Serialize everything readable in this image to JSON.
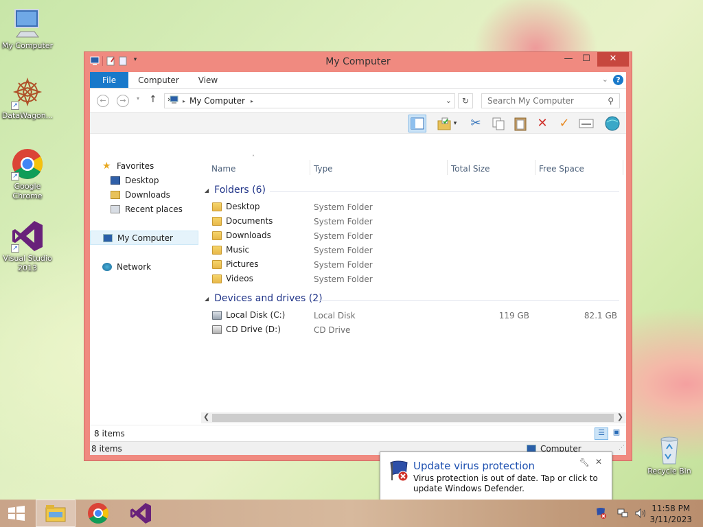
{
  "desktop": {
    "icons": [
      {
        "label": "My Computer"
      },
      {
        "label": "DataWagon..."
      },
      {
        "label": "Google Chrome"
      },
      {
        "label": "Visual Studio 2013"
      },
      {
        "label": "Recycle Bin"
      }
    ]
  },
  "window": {
    "title": "My Computer",
    "ribbon_tabs": [
      "File",
      "Computer",
      "View"
    ],
    "address": {
      "root_label": "My Computer"
    },
    "search": {
      "placeholder": "Search My Computer"
    },
    "nav": {
      "favorites": "Favorites",
      "favorites_items": [
        "Desktop",
        "Downloads",
        "Recent places"
      ],
      "my_computer": "My Computer",
      "network": "Network"
    },
    "columns": [
      "Name",
      "Type",
      "Total Size",
      "Free Space"
    ],
    "groups": [
      {
        "title": "Folders (6)",
        "items": [
          {
            "name": "Desktop",
            "type": "System Folder",
            "total": "",
            "free": ""
          },
          {
            "name": "Documents",
            "type": "System Folder",
            "total": "",
            "free": ""
          },
          {
            "name": "Downloads",
            "type": "System Folder",
            "total": "",
            "free": ""
          },
          {
            "name": "Music",
            "type": "System Folder",
            "total": "",
            "free": ""
          },
          {
            "name": "Pictures",
            "type": "System Folder",
            "total": "",
            "free": ""
          },
          {
            "name": "Videos",
            "type": "System Folder",
            "total": "",
            "free": ""
          }
        ]
      },
      {
        "title": "Devices and drives (2)",
        "items": [
          {
            "name": "Local Disk (C:)",
            "type": "Local Disk",
            "total": "119 GB",
            "free": "82.1 GB"
          },
          {
            "name": "CD Drive (D:)",
            "type": "CD Drive",
            "total": "",
            "free": ""
          }
        ]
      }
    ],
    "status_items": "8 items",
    "status_bottom_left": "8 items",
    "status_bottom_right": "Computer"
  },
  "toast": {
    "title": "Update virus protection",
    "message": "Virus protection is out of date. Tap or click to update Windows Defender."
  },
  "clock": {
    "time": "11:58 PM",
    "date": "3/11/2023"
  }
}
